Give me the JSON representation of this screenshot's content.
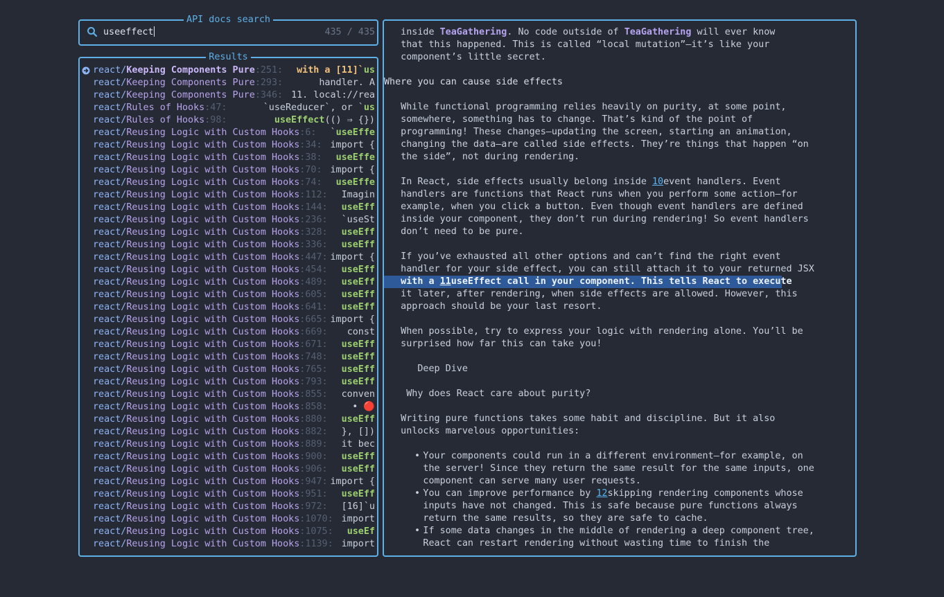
{
  "search": {
    "title": "API docs search",
    "query": "useeffect",
    "count": "435 / 435"
  },
  "results": {
    "title": "Results",
    "items": [
      {
        "source": "react/",
        "page": "Keeping Components Pure",
        "line": ":251:",
        "pre": "with a [11]`",
        "match": "us",
        "post": ""
      },
      {
        "source": "react/",
        "page": "Keeping Components Pure",
        "line": ":293:",
        "pre": "handler. A",
        "match": "",
        "post": ""
      },
      {
        "source": "react/",
        "page": "Keeping Components Pure",
        "line": ":346:",
        "pre": "11. local://rea",
        "match": "",
        "post": ""
      },
      {
        "source": "react/",
        "page": "Rules of Hooks",
        "line": ":47:",
        "pre": "`useReducer`, or `",
        "match": "us",
        "post": ""
      },
      {
        "source": "react/",
        "page": "Rules of Hooks",
        "line": ":98:",
        "pre": "",
        "match": "useEffect",
        "post": "(() ⇒ {})"
      },
      {
        "source": "react/",
        "page": "Reusing Logic with Custom Hooks",
        "line": ":6:",
        "pre": "`",
        "match": "useEffe",
        "post": ""
      },
      {
        "source": "react/",
        "page": "Reusing Logic with Custom Hooks",
        "line": ":34:",
        "pre": "import {",
        "match": "",
        "post": ""
      },
      {
        "source": "react/",
        "page": "Reusing Logic with Custom Hooks",
        "line": ":38:",
        "pre": "",
        "match": "useEffe",
        "post": ""
      },
      {
        "source": "react/",
        "page": "Reusing Logic with Custom Hooks",
        "line": ":70:",
        "pre": "import {",
        "match": "",
        "post": ""
      },
      {
        "source": "react/",
        "page": "Reusing Logic with Custom Hooks",
        "line": ":74:",
        "pre": "",
        "match": "useEffe",
        "post": ""
      },
      {
        "source": "react/",
        "page": "Reusing Logic with Custom Hooks",
        "line": ":112:",
        "pre": "Imagin",
        "match": "",
        "post": ""
      },
      {
        "source": "react/",
        "page": "Reusing Logic with Custom Hooks",
        "line": ":144:",
        "pre": "",
        "match": "useEff",
        "post": ""
      },
      {
        "source": "react/",
        "page": "Reusing Logic with Custom Hooks",
        "line": ":236:",
        "pre": "`useSt",
        "match": "",
        "post": ""
      },
      {
        "source": "react/",
        "page": "Reusing Logic with Custom Hooks",
        "line": ":328:",
        "pre": "",
        "match": "useEff",
        "post": ""
      },
      {
        "source": "react/",
        "page": "Reusing Logic with Custom Hooks",
        "line": ":336:",
        "pre": "",
        "match": "useEff",
        "post": ""
      },
      {
        "source": "react/",
        "page": "Reusing Logic with Custom Hooks",
        "line": ":447:",
        "pre": "import {",
        "match": "",
        "post": ""
      },
      {
        "source": "react/",
        "page": "Reusing Logic with Custom Hooks",
        "line": ":454:",
        "pre": "",
        "match": "useEff",
        "post": ""
      },
      {
        "source": "react/",
        "page": "Reusing Logic with Custom Hooks",
        "line": ":489:",
        "pre": "",
        "match": "useEff",
        "post": ""
      },
      {
        "source": "react/",
        "page": "Reusing Logic with Custom Hooks",
        "line": ":605:",
        "pre": "",
        "match": "useEff",
        "post": ""
      },
      {
        "source": "react/",
        "page": "Reusing Logic with Custom Hooks",
        "line": ":641:",
        "pre": "",
        "match": "useEff",
        "post": ""
      },
      {
        "source": "react/",
        "page": "Reusing Logic with Custom Hooks",
        "line": ":665:",
        "pre": "import {",
        "match": "",
        "post": ""
      },
      {
        "source": "react/",
        "page": "Reusing Logic with Custom Hooks",
        "line": ":669:",
        "pre": "const",
        "match": "",
        "post": ""
      },
      {
        "source": "react/",
        "page": "Reusing Logic with Custom Hooks",
        "line": ":671:",
        "pre": "",
        "match": "useEff",
        "post": ""
      },
      {
        "source": "react/",
        "page": "Reusing Logic with Custom Hooks",
        "line": ":748:",
        "pre": "",
        "match": "useEff",
        "post": ""
      },
      {
        "source": "react/",
        "page": "Reusing Logic with Custom Hooks",
        "line": ":765:",
        "pre": "",
        "match": "useEff",
        "post": ""
      },
      {
        "source": "react/",
        "page": "Reusing Logic with Custom Hooks",
        "line": ":793:",
        "pre": "",
        "match": "useEff",
        "post": ""
      },
      {
        "source": "react/",
        "page": "Reusing Logic with Custom Hooks",
        "line": ":855:",
        "pre": "conven",
        "match": "",
        "post": ""
      },
      {
        "source": "react/",
        "page": "Reusing Logic with Custom Hooks",
        "line": ":858:",
        "pre": "• 🔴",
        "match": "",
        "post": ""
      },
      {
        "source": "react/",
        "page": "Reusing Logic with Custom Hooks",
        "line": ":880:",
        "pre": "",
        "match": "useEff",
        "post": ""
      },
      {
        "source": "react/",
        "page": "Reusing Logic with Custom Hooks",
        "line": ":882:",
        "pre": "}, [])",
        "match": "",
        "post": ""
      },
      {
        "source": "react/",
        "page": "Reusing Logic with Custom Hooks",
        "line": ":889:",
        "pre": "it bec",
        "match": "",
        "post": ""
      },
      {
        "source": "react/",
        "page": "Reusing Logic with Custom Hooks",
        "line": ":900:",
        "pre": "",
        "match": "useEff",
        "post": ""
      },
      {
        "source": "react/",
        "page": "Reusing Logic with Custom Hooks",
        "line": ":906:",
        "pre": "",
        "match": "useEff",
        "post": ""
      },
      {
        "source": "react/",
        "page": "Reusing Logic with Custom Hooks",
        "line": ":947:",
        "pre": "import {",
        "match": "",
        "post": ""
      },
      {
        "source": "react/",
        "page": "Reusing Logic with Custom Hooks",
        "line": ":951:",
        "pre": "",
        "match": "useEff",
        "post": ""
      },
      {
        "source": "react/",
        "page": "Reusing Logic with Custom Hooks",
        "line": ":972:",
        "pre": "[16]`u",
        "match": "",
        "post": ""
      },
      {
        "source": "react/",
        "page": "Reusing Logic with Custom Hooks",
        "line": ":1070:",
        "pre": "import",
        "match": "",
        "post": ""
      },
      {
        "source": "react/",
        "page": "Reusing Logic with Custom Hooks",
        "line": ":1075:",
        "pre": "",
        "match": "useEf",
        "post": ""
      },
      {
        "source": "react/",
        "page": "Reusing Logic with Custom Hooks",
        "line": ":1139:",
        "pre": "import",
        "match": "",
        "post": ""
      }
    ]
  },
  "preview": {
    "lines": [
      {
        "segments": [
          {
            "t": "   inside "
          },
          {
            "t": "TeaGathering",
            "c": "teag"
          },
          {
            "t": ". No code outside of "
          },
          {
            "t": "TeaGathering",
            "c": "teag"
          },
          {
            "t": " will ever know"
          }
        ]
      },
      {
        "segments": [
          {
            "t": "   that this happened. This is called “local mutation”—it’s like your"
          }
        ]
      },
      {
        "segments": [
          {
            "t": "   component’s little secret."
          }
        ]
      },
      {
        "segments": [
          {
            "t": ""
          }
        ]
      },
      {
        "kind": "heading",
        "segments": [
          {
            "t": "Where you can cause side effects"
          }
        ]
      },
      {
        "segments": [
          {
            "t": ""
          }
        ]
      },
      {
        "segments": [
          {
            "t": "   While functional programming relies heavily on purity, at some point,"
          }
        ]
      },
      {
        "segments": [
          {
            "t": "   somewhere, something has to change. That’s kind of the point of"
          }
        ]
      },
      {
        "segments": [
          {
            "t": "   programming! These changes—updating the screen, starting an animation,"
          }
        ]
      },
      {
        "segments": [
          {
            "t": "   changing the data—are called side effects. They’re things that happen “on"
          }
        ]
      },
      {
        "segments": [
          {
            "t": "   the side”, not during rendering."
          }
        ]
      },
      {
        "segments": [
          {
            "t": ""
          }
        ]
      },
      {
        "segments": [
          {
            "t": "   In React, side effects usually belong inside "
          },
          {
            "t": "10",
            "c": "lnk"
          },
          {
            "t": "event handlers. Event"
          }
        ]
      },
      {
        "segments": [
          {
            "t": "   handlers are functions that React runs when you perform some action—for"
          }
        ]
      },
      {
        "segments": [
          {
            "t": "   example, when you click a button. Even though event handlers are defined"
          }
        ]
      },
      {
        "segments": [
          {
            "t": "   inside your component, they don’t run during rendering! So event handlers"
          }
        ]
      },
      {
        "segments": [
          {
            "t": "   don’t need to be pure."
          }
        ]
      },
      {
        "segments": [
          {
            "t": ""
          }
        ]
      },
      {
        "segments": [
          {
            "t": "   If you’ve exhausted all other options and can’t find the right event"
          }
        ]
      },
      {
        "segments": [
          {
            "t": "   handler for your side effect, you can still attach it to your returned JSX"
          }
        ]
      },
      {
        "kind": "sel",
        "segments": [
          {
            "t": "   with a "
          },
          {
            "t": "11",
            "c": "u"
          },
          {
            "t": "useEffect call in your component. This tells React to execute"
          }
        ]
      },
      {
        "segments": [
          {
            "t": "   it later, after rendering, when side effects are allowed. However, this"
          }
        ]
      },
      {
        "segments": [
          {
            "t": "   approach should be your last resort."
          }
        ]
      },
      {
        "segments": [
          {
            "t": ""
          }
        ]
      },
      {
        "segments": [
          {
            "t": "   When possible, try to express your logic with rendering alone. You’ll be"
          }
        ]
      },
      {
        "segments": [
          {
            "t": "   surprised how far this can take you!"
          }
        ]
      },
      {
        "segments": [
          {
            "t": ""
          }
        ]
      },
      {
        "segments": [
          {
            "t": "      Deep Dive"
          }
        ]
      },
      {
        "segments": [
          {
            "t": ""
          }
        ]
      },
      {
        "segments": [
          {
            "t": "    Why does React care about purity?"
          }
        ]
      },
      {
        "segments": [
          {
            "t": ""
          }
        ]
      },
      {
        "segments": [
          {
            "t": "   Writing pure functions takes some habit and discipline. But it also"
          }
        ]
      },
      {
        "segments": [
          {
            "t": "   unlocks marvelous opportunities:"
          }
        ]
      },
      {
        "segments": [
          {
            "t": ""
          }
        ]
      },
      {
        "bullet": "•",
        "segments": [
          {
            "t": "       Your components could run in a different environment—for example, on"
          }
        ]
      },
      {
        "segments": [
          {
            "t": "       the server! Since they return the same result for the same inputs, one"
          }
        ]
      },
      {
        "segments": [
          {
            "t": "       component can serve many user requests."
          }
        ]
      },
      {
        "bullet": "•",
        "segments": [
          {
            "t": "       You can improve performance by "
          },
          {
            "t": "12",
            "c": "lnk"
          },
          {
            "t": "skipping rendering components whose"
          }
        ]
      },
      {
        "segments": [
          {
            "t": "       inputs have not changed. This is safe because pure functions always"
          }
        ]
      },
      {
        "segments": [
          {
            "t": "       return the same results, so they are safe to cache."
          }
        ]
      },
      {
        "bullet": "•",
        "segments": [
          {
            "t": "       If some data changes in the middle of rendering a deep component tree,"
          }
        ]
      },
      {
        "segments": [
          {
            "t": "       React can restart rendering without wasting time to finish the"
          }
        ]
      }
    ]
  },
  "colors": {
    "border": "#5fb0e6",
    "background": "#252a35",
    "match": "#9ccf6f",
    "selection": "#2f5a99"
  }
}
